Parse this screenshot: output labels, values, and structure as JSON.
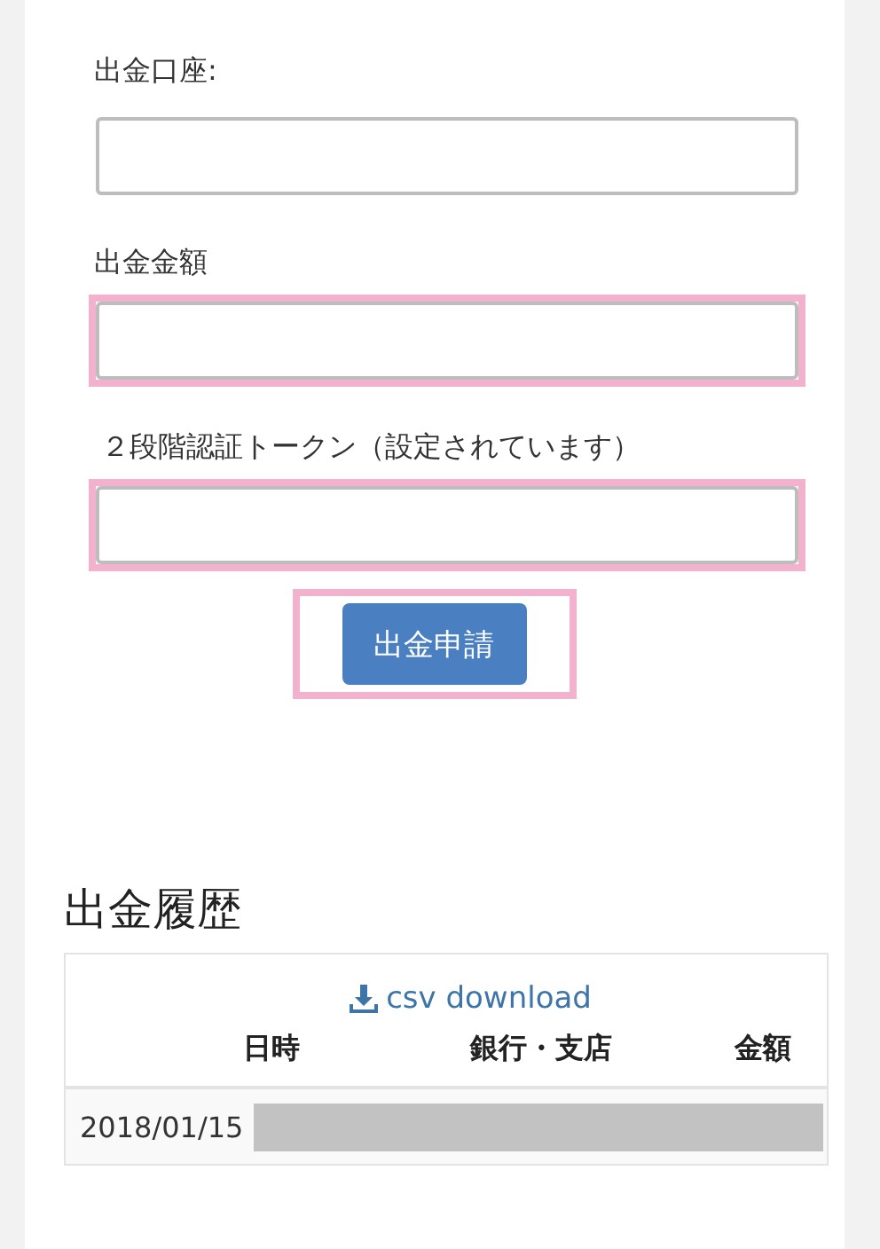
{
  "form": {
    "fields": [
      {
        "label": "出金口座:",
        "highlighted": false
      },
      {
        "label": "出金金額",
        "highlighted": true
      },
      {
        "label": "２段階認証トークン（設定されています）",
        "highlighted": true
      }
    ],
    "submit": {
      "label": "出金申請",
      "highlighted": true
    }
  },
  "history": {
    "title": "出金履歴",
    "download_link": "csv download",
    "columns": [
      "日時",
      "銀行・支店",
      "金額"
    ],
    "rows": [
      {
        "date": "2018/01/15",
        "redacted": true
      }
    ]
  }
}
